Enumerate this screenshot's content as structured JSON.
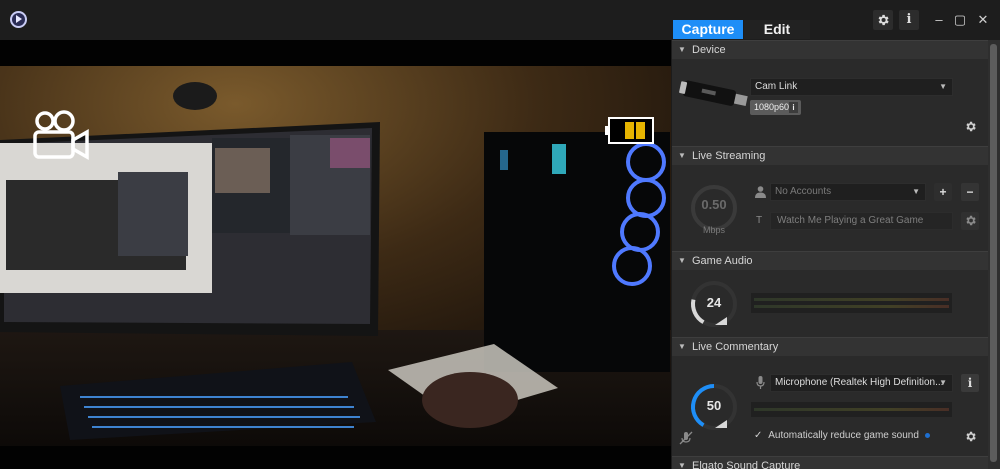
{
  "app": {
    "logo_icon": "play-circle-icon"
  },
  "tabs": [
    {
      "label": "Capture",
      "active": true
    },
    {
      "label": "Edit",
      "active": false
    }
  ],
  "header_buttons": {
    "settings_icon": "gear-icon",
    "info_label": "i"
  },
  "window_controls": {
    "minimize": "–",
    "maximize": "▢",
    "close": "✕"
  },
  "preview": {
    "camera_overlay_icon": "video-camera-icon",
    "battery_overlay_icon": "battery-icon",
    "battery_level": 0.75
  },
  "sections": {
    "device": {
      "title": "Device",
      "device_icon": "usb-capture-stick-icon",
      "selected_device": "Cam Link",
      "format_badge": "1080p60",
      "format_info_icon": "info-icon"
    },
    "live_streaming": {
      "title": "Live Streaming",
      "bitrate_value": "0.50",
      "bitrate_unit": "Mbps",
      "account_placeholder": "No Accounts",
      "add_label": "+",
      "remove_label": "−",
      "title_field_icon_label": "T",
      "title_placeholder": "Watch Me Playing a Great Game"
    },
    "game_audio": {
      "title": "Game Audio",
      "volume_value": "24",
      "volume_fraction": 0.24
    },
    "live_commentary": {
      "title": "Live Commentary",
      "volume_value": "50",
      "volume_fraction": 0.5,
      "microphone": "Microphone (Realtek High Definition...",
      "info_label": "i",
      "auto_reduce_checked": true,
      "auto_reduce_label": "Automatically reduce game sound",
      "mute_icon": "microphone-muted-icon"
    },
    "elgato_sound_capture": {
      "title": "Elgato Sound Capture"
    }
  },
  "colors": {
    "accent": "#1e8ef7",
    "panel": "#2a2a2a",
    "section_header": "#333333"
  }
}
